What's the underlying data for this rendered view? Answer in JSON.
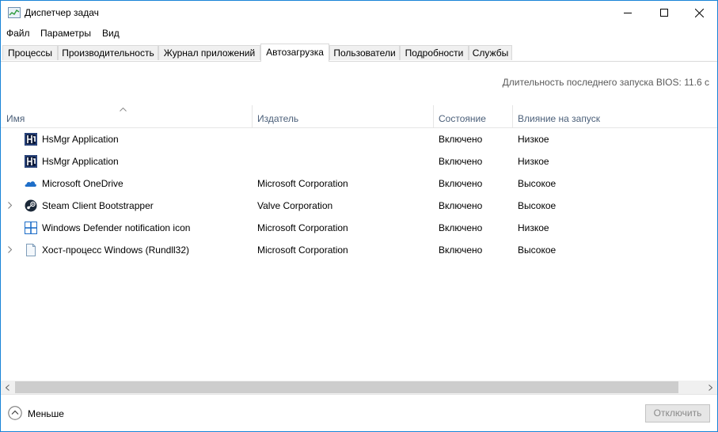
{
  "window": {
    "title": "Диспетчер задач",
    "controls": [
      "minimize",
      "maximize",
      "close"
    ]
  },
  "menu": [
    "Файл",
    "Параметры",
    "Вид"
  ],
  "tabs": [
    "Процессы",
    "Производительность",
    "Журнал приложений",
    "Автозагрузка",
    "Пользователи",
    "Подробности",
    "Службы"
  ],
  "active_tab": "Автозагрузка",
  "bios_time": "Длительность последнего запуска BIOS:  11.6 с",
  "columns": [
    "Имя",
    "Издатель",
    "Состояние",
    "Влияние на запуск"
  ],
  "rows": [
    {
      "name": "HsMgr Application",
      "publisher": "",
      "status": "Включено",
      "impact": "Низкое",
      "icon": "hsmgr-icon",
      "expandable": false
    },
    {
      "name": "HsMgr Application",
      "publisher": "",
      "status": "Включено",
      "impact": "Низкое",
      "icon": "hsmgr-icon",
      "expandable": false
    },
    {
      "name": "Microsoft OneDrive",
      "publisher": "Microsoft Corporation",
      "status": "Включено",
      "impact": "Высокое",
      "icon": "onedrive-icon",
      "expandable": false
    },
    {
      "name": "Steam Client Bootstrapper",
      "publisher": "Valve Corporation",
      "status": "Включено",
      "impact": "Высокое",
      "icon": "steam-icon",
      "expandable": true
    },
    {
      "name": "Windows Defender notification icon",
      "publisher": "Microsoft Corporation",
      "status": "Включено",
      "impact": "Низкое",
      "icon": "defender-icon",
      "expandable": false
    },
    {
      "name": "Хост-процесс Windows (Rundll32)",
      "publisher": "Microsoft Corporation",
      "status": "Включено",
      "impact": "Высокое",
      "icon": "rundll-icon",
      "expandable": true
    }
  ],
  "footer": {
    "less_label": "Меньше",
    "disable_label": "Отключить"
  },
  "colors": {
    "window_border": "#1883d7",
    "header_text": "#4c607a",
    "tab_bg": "#f0f0f0"
  }
}
